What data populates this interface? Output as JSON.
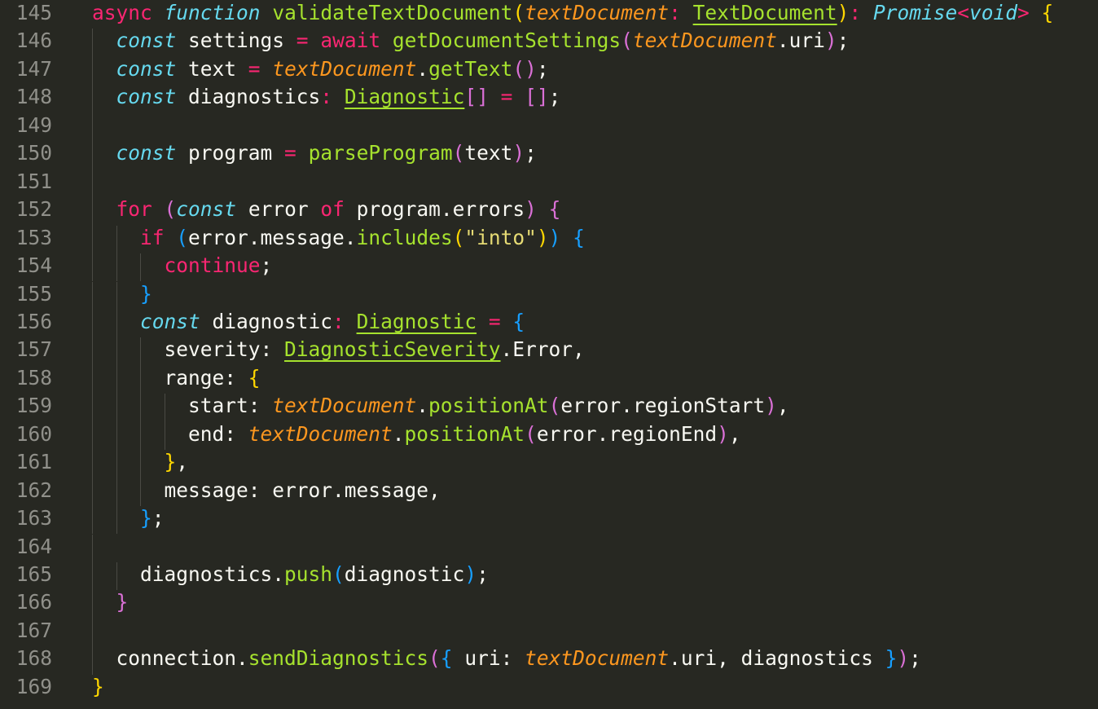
{
  "editor": {
    "theme": "dark",
    "colors": {
      "background": "#272822",
      "line_number": "#90908a",
      "plain": "#f8f8f2",
      "keyword": "#f92672",
      "storage": "#66d9ef",
      "function": "#a6e22e",
      "parameter": "#fd971f",
      "string": "#e6db74",
      "type": "#a6e22e",
      "paren_level_1": "#ffd700",
      "paren_level_2": "#da70d6",
      "paren_level_3": "#179fff",
      "guide": "#4a4a44",
      "whitespace_dot": "#555550"
    },
    "lines": [
      {
        "num": "145",
        "indent": 0,
        "tokens": [
          {
            "t": "async",
            "c": "keyword"
          },
          {
            "t": " "
          },
          {
            "t": "function",
            "c": "storage",
            "i": true
          },
          {
            "t": " "
          },
          {
            "t": "validateTextDocument",
            "c": "function"
          },
          {
            "t": "(",
            "c": "paren_level_1"
          },
          {
            "t": "textDocument",
            "c": "parameter",
            "i": true
          },
          {
            "t": ":",
            "c": "keyword"
          },
          {
            "t": " "
          },
          {
            "t": "TextDocument",
            "c": "type",
            "u": true
          },
          {
            "t": ")",
            "c": "paren_level_1"
          },
          {
            "t": ":",
            "c": "keyword"
          },
          {
            "t": " "
          },
          {
            "t": "Promise",
            "c": "storage",
            "i": true
          },
          {
            "t": "<",
            "c": "keyword"
          },
          {
            "t": "void",
            "c": "storage",
            "i": true
          },
          {
            "t": ">",
            "c": "keyword"
          },
          {
            "t": " "
          },
          {
            "t": "{",
            "c": "paren_level_1"
          }
        ]
      },
      {
        "num": "146",
        "indent": 1,
        "tokens": [
          {
            "t": "const",
            "c": "storage",
            "i": true
          },
          {
            "t": " settings "
          },
          {
            "t": "=",
            "c": "keyword"
          },
          {
            "t": " "
          },
          {
            "t": "await",
            "c": "keyword"
          },
          {
            "t": " "
          },
          {
            "t": "getDocumentSettings",
            "c": "function"
          },
          {
            "t": "(",
            "c": "paren_level_2"
          },
          {
            "t": "textDocument",
            "c": "parameter",
            "i": true
          },
          {
            "t": ".uri"
          },
          {
            "t": ")",
            "c": "paren_level_2"
          },
          {
            "t": ";"
          }
        ]
      },
      {
        "num": "147",
        "indent": 1,
        "tokens": [
          {
            "t": "const",
            "c": "storage",
            "i": true
          },
          {
            "t": " text "
          },
          {
            "t": "=",
            "c": "keyword"
          },
          {
            "t": " "
          },
          {
            "t": "textDocument",
            "c": "parameter",
            "i": true
          },
          {
            "t": "."
          },
          {
            "t": "getText",
            "c": "function"
          },
          {
            "t": "()",
            "c": "paren_level_2"
          },
          {
            "t": ";"
          }
        ]
      },
      {
        "num": "148",
        "indent": 1,
        "tokens": [
          {
            "t": "const",
            "c": "storage",
            "i": true
          },
          {
            "t": " diagnostics"
          },
          {
            "t": ":",
            "c": "keyword"
          },
          {
            "t": " "
          },
          {
            "t": "Diagnostic",
            "c": "type",
            "u": true
          },
          {
            "t": "[]",
            "c": "paren_level_2"
          },
          {
            "t": " "
          },
          {
            "t": "=",
            "c": "keyword"
          },
          {
            "t": " "
          },
          {
            "t": "[]",
            "c": "paren_level_2"
          },
          {
            "t": ";"
          }
        ]
      },
      {
        "num": "149",
        "indent": 0,
        "tokens": []
      },
      {
        "num": "150",
        "indent": 1,
        "tokens": [
          {
            "t": "const",
            "c": "storage",
            "i": true
          },
          {
            "t": " program "
          },
          {
            "t": "=",
            "c": "keyword"
          },
          {
            "t": " "
          },
          {
            "t": "parseProgram",
            "c": "function"
          },
          {
            "t": "(",
            "c": "paren_level_2"
          },
          {
            "t": "text"
          },
          {
            "t": ")",
            "c": "paren_level_2"
          },
          {
            "t": ";"
          }
        ]
      },
      {
        "num": "151",
        "indent": 0,
        "tokens": []
      },
      {
        "num": "152",
        "indent": 1,
        "tokens": [
          {
            "t": "for",
            "c": "keyword"
          },
          {
            "t": " "
          },
          {
            "t": "(",
            "c": "paren_level_2"
          },
          {
            "t": "const",
            "c": "storage",
            "i": true
          },
          {
            "t": " error "
          },
          {
            "t": "of",
            "c": "keyword"
          },
          {
            "t": " program.errors"
          },
          {
            "t": ")",
            "c": "paren_level_2"
          },
          {
            "t": " "
          },
          {
            "t": "{",
            "c": "paren_level_2"
          }
        ]
      },
      {
        "num": "153",
        "indent": 2,
        "tokens": [
          {
            "t": "if",
            "c": "keyword"
          },
          {
            "t": " "
          },
          {
            "t": "(",
            "c": "paren_level_3"
          },
          {
            "t": "error.message."
          },
          {
            "t": "includes",
            "c": "function"
          },
          {
            "t": "(",
            "c": "paren_level_1"
          },
          {
            "t": "\"into\"",
            "c": "string"
          },
          {
            "t": ")",
            "c": "paren_level_1"
          },
          {
            "t": ")",
            "c": "paren_level_3"
          },
          {
            "t": " "
          },
          {
            "t": "{",
            "c": "paren_level_3"
          }
        ]
      },
      {
        "num": "154",
        "indent": 3,
        "tokens": [
          {
            "t": "continue",
            "c": "keyword"
          },
          {
            "t": ";"
          }
        ]
      },
      {
        "num": "155",
        "indent": 2,
        "tokens": [
          {
            "t": "}",
            "c": "paren_level_3"
          }
        ]
      },
      {
        "num": "156",
        "indent": 2,
        "tokens": [
          {
            "t": "const",
            "c": "storage",
            "i": true
          },
          {
            "t": " diagnostic"
          },
          {
            "t": ":",
            "c": "keyword"
          },
          {
            "t": " "
          },
          {
            "t": "Diagnostic",
            "c": "type",
            "u": true
          },
          {
            "t": " "
          },
          {
            "t": "=",
            "c": "keyword"
          },
          {
            "t": " "
          },
          {
            "t": "{",
            "c": "paren_level_3"
          }
        ]
      },
      {
        "num": "157",
        "indent": 3,
        "tokens": [
          {
            "t": "severity: "
          },
          {
            "t": "DiagnosticSeverity",
            "c": "type",
            "u": true
          },
          {
            "t": ".Error,"
          }
        ]
      },
      {
        "num": "158",
        "indent": 3,
        "tokens": [
          {
            "t": "range: "
          },
          {
            "t": "{",
            "c": "paren_level_1"
          }
        ]
      },
      {
        "num": "159",
        "indent": 4,
        "tokens": [
          {
            "t": "start: "
          },
          {
            "t": "textDocument",
            "c": "parameter",
            "i": true
          },
          {
            "t": "."
          },
          {
            "t": "positionAt",
            "c": "function"
          },
          {
            "t": "(",
            "c": "paren_level_2"
          },
          {
            "t": "error.regionStart"
          },
          {
            "t": ")",
            "c": "paren_level_2"
          },
          {
            "t": ","
          }
        ]
      },
      {
        "num": "160",
        "indent": 4,
        "tokens": [
          {
            "t": "end: "
          },
          {
            "t": "textDocument",
            "c": "parameter",
            "i": true
          },
          {
            "t": "."
          },
          {
            "t": "positionAt",
            "c": "function"
          },
          {
            "t": "(",
            "c": "paren_level_2"
          },
          {
            "t": "error.regionEnd"
          },
          {
            "t": ")",
            "c": "paren_level_2"
          },
          {
            "t": ","
          }
        ]
      },
      {
        "num": "161",
        "indent": 3,
        "tokens": [
          {
            "t": "}",
            "c": "paren_level_1"
          },
          {
            "t": ","
          }
        ]
      },
      {
        "num": "162",
        "indent": 3,
        "tokens": [
          {
            "t": "message: error.message,"
          }
        ]
      },
      {
        "num": "163",
        "indent": 2,
        "tokens": [
          {
            "t": "}",
            "c": "paren_level_3"
          },
          {
            "t": ";"
          }
        ]
      },
      {
        "num": "164",
        "indent": 0,
        "tokens": []
      },
      {
        "num": "165",
        "indent": 2,
        "tokens": [
          {
            "t": "diagnostics."
          },
          {
            "t": "push",
            "c": "function"
          },
          {
            "t": "(",
            "c": "paren_level_3"
          },
          {
            "t": "diagnostic"
          },
          {
            "t": ")",
            "c": "paren_level_3"
          },
          {
            "t": ";"
          }
        ]
      },
      {
        "num": "166",
        "indent": 1,
        "tokens": [
          {
            "t": "}",
            "c": "paren_level_2"
          }
        ]
      },
      {
        "num": "167",
        "indent": 0,
        "tokens": []
      },
      {
        "num": "168",
        "indent": 1,
        "tokens": [
          {
            "t": "connection."
          },
          {
            "t": "sendDiagnostics",
            "c": "function"
          },
          {
            "t": "(",
            "c": "paren_level_2"
          },
          {
            "t": "{",
            "c": "paren_level_3"
          },
          {
            "t": " uri: "
          },
          {
            "t": "textDocument",
            "c": "parameter",
            "i": true
          },
          {
            "t": ".uri, diagnostics "
          },
          {
            "t": "}",
            "c": "paren_level_3"
          },
          {
            "t": ")",
            "c": "paren_level_2"
          },
          {
            "t": ";"
          }
        ]
      },
      {
        "num": "169",
        "indent": 0,
        "tokens": [
          {
            "t": "}",
            "c": "paren_level_1"
          }
        ]
      }
    ]
  }
}
